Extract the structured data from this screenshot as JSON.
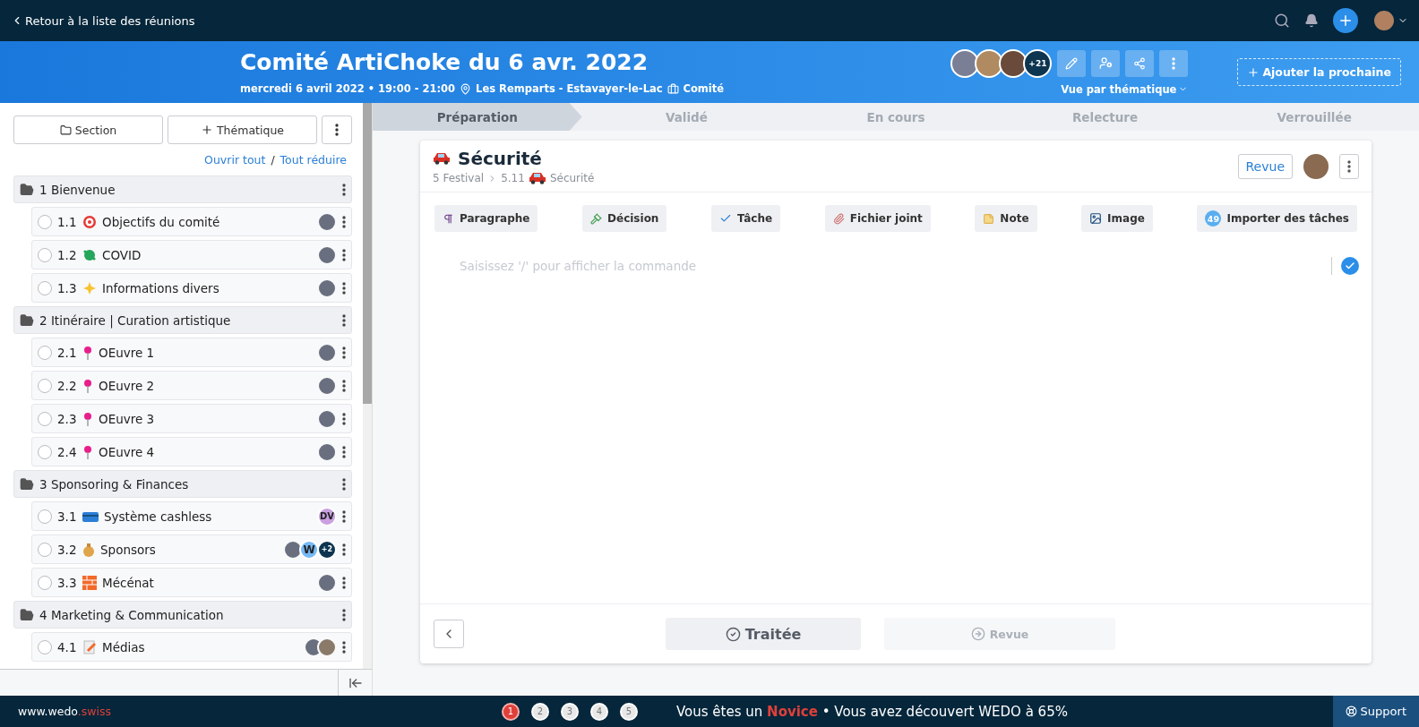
{
  "topbar": {
    "back_link": "Retour à la liste des réunions"
  },
  "meeting": {
    "title": "Comité ArtiChoke du 6 avr. 2022",
    "datetime": "mercredi 6 avril 2022 • 19:00 - 21:00",
    "location": "Les Remparts - Estavayer-le-Lac",
    "type": "Comité",
    "more_participants": "+21",
    "view_selector": "Vue par thématique",
    "add_next": "Ajouter la prochaine"
  },
  "sidebar": {
    "buttons": [
      "Section",
      "Thématique"
    ],
    "open_all": "Ouvrir tout",
    "separator": "/",
    "collapse_all": "Tout réduire",
    "sections": [
      {
        "label": "1 Bienvenue",
        "children": [
          {
            "number": "1.1",
            "label": "Objectifs du comité",
            "checked": false,
            "avatars": [
              {
                "kind": "photo"
              }
            ]
          },
          {
            "number": "1.2",
            "label": "COVID",
            "checked": false,
            "avatars": [
              {
                "kind": "photo"
              }
            ]
          },
          {
            "number": "1.3",
            "label": "Informations divers",
            "checked": false,
            "avatars": [
              {
                "kind": "photo"
              }
            ]
          }
        ]
      },
      {
        "label": "2 Itinéraire | Curation artistique",
        "children": [
          {
            "number": "2.1",
            "label": "OEuvre 1",
            "checked": false,
            "avatars": [
              {
                "kind": "photo"
              }
            ]
          },
          {
            "number": "2.2",
            "label": "OEuvre 2",
            "checked": false,
            "avatars": [
              {
                "kind": "photo"
              }
            ]
          },
          {
            "number": "2.3",
            "label": "OEuvre 3",
            "checked": false,
            "avatars": [
              {
                "kind": "photo"
              }
            ]
          },
          {
            "number": "2.4",
            "label": "OEuvre 4",
            "checked": false,
            "avatars": [
              {
                "kind": "photo"
              }
            ]
          }
        ]
      },
      {
        "label": "3 Sponsoring & Finances",
        "children": [
          {
            "number": "3.1",
            "label": "Système cashless",
            "checked": false,
            "avatars": [
              {
                "kind": "initials",
                "text": "DV"
              }
            ]
          },
          {
            "number": "3.2",
            "label": "Sponsors",
            "checked": false,
            "avatars": [
              {
                "kind": "photo"
              },
              {
                "kind": "initials",
                "text": "W"
              },
              {
                "kind": "count",
                "text": "+2"
              }
            ]
          },
          {
            "number": "3.3",
            "label": "Mécénat",
            "checked": false,
            "avatars": [
              {
                "kind": "photo"
              }
            ]
          }
        ]
      },
      {
        "label": "4 Marketing & Communication",
        "children": [
          {
            "number": "4.1",
            "label": "Médias",
            "checked": false,
            "avatars": [
              {
                "kind": "photo"
              },
              {
                "kind": "photo"
              }
            ]
          }
        ]
      }
    ]
  },
  "steps": [
    {
      "label": "Préparation",
      "selected": true
    },
    {
      "label": "Validé",
      "selected": false
    },
    {
      "label": "En cours",
      "selected": false
    },
    {
      "label": "Relecture",
      "selected": false
    },
    {
      "label": "Verrouillée",
      "selected": false
    }
  ],
  "topic": {
    "title": "Sécurité",
    "breadcrumb": [
      "5 Festival",
      "5.11",
      "Sécurité"
    ],
    "review_button": "Revue",
    "blocks": [
      "Paragraphe",
      "Décision",
      "Tâche",
      "Fichier joint",
      "Note",
      "Image",
      "Importer des tâches"
    ],
    "import_count": "49",
    "editor": {
      "placeholder": "Saisissez '/' pour afficher la commande"
    },
    "done_button": "Traitée",
    "review_next": {
      "label": "Revue",
      "disabled": true
    }
  },
  "footer": {
    "site": "www.wedo**.swiss**",
    "levels": [
      {
        "label": "1",
        "selected": true
      },
      {
        "label": "2",
        "selected": false
      },
      {
        "label": "3",
        "selected": false
      },
      {
        "label": "4",
        "selected": false
      },
      {
        "label": "5",
        "selected": false
      }
    ],
    "progress": "Vous êtes un **Novice** • Vous avez découvert WEDO à 65%",
    "support": "Support"
  }
}
